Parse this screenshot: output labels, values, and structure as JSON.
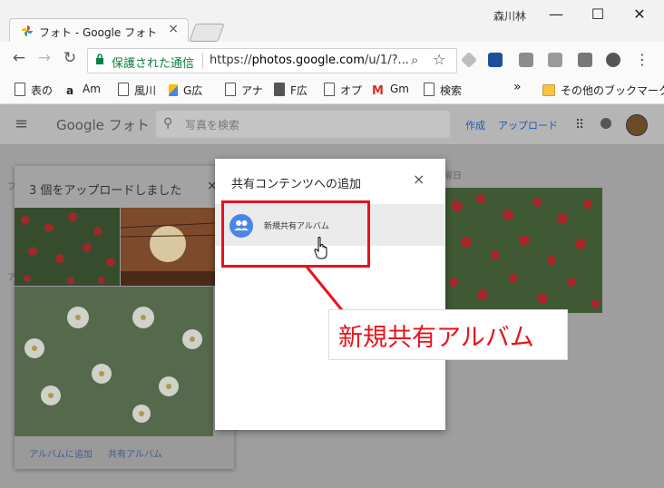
{
  "browser": {
    "tab_title": "フォト - Google フォト",
    "tab_close": "×",
    "user_name": "森川林",
    "window_controls": {
      "minimize": "—",
      "maximize": "☐",
      "close": "✕"
    },
    "nav": {
      "back": "←",
      "forward": "→",
      "reload": "↻"
    },
    "address": {
      "secure_label": "保護された通信",
      "url_scheme": "https://",
      "url_domain": "photos.google.com",
      "url_path": "/u/1/?..."
    },
    "menu_icon": "⋮"
  },
  "bookmarks": {
    "items": [
      {
        "label": "表の",
        "icon": "page-icon"
      },
      {
        "label": "Am",
        "icon": "amazon-icon"
      },
      {
        "label": "風川",
        "icon": "page-icon"
      },
      {
        "label": "G広",
        "icon": "google-ads-icon"
      },
      {
        "label": "アナ",
        "icon": "page-icon"
      },
      {
        "label": "F広",
        "icon": "facebook-icon"
      },
      {
        "label": "オプ",
        "icon": "page-icon"
      },
      {
        "label": "Gm",
        "icon": "gmail-icon"
      },
      {
        "label": "検索",
        "icon": "page-icon"
      }
    ],
    "more": "»",
    "other_folder": "その他のブックマーク"
  },
  "app": {
    "logo_google": "Google",
    "logo_photos": "フォト",
    "search_placeholder": "写真を検索",
    "create": "作成",
    "upload": "アップロード"
  },
  "background": {
    "date_label": "曜日",
    "letter1": "プ",
    "letter2": "ア"
  },
  "upload_card": {
    "title": "3 個をアップロードしました",
    "close": "×",
    "link_add_album": "アルバムに追加",
    "link_shared_album": "共有アルバム"
  },
  "dialog": {
    "title": "共有コンテンツへの追加",
    "close": "×",
    "item_label": "新規共有アルバム"
  },
  "annotation": {
    "callout_text": "新規共有アルバム",
    "color": "#e8121b"
  }
}
